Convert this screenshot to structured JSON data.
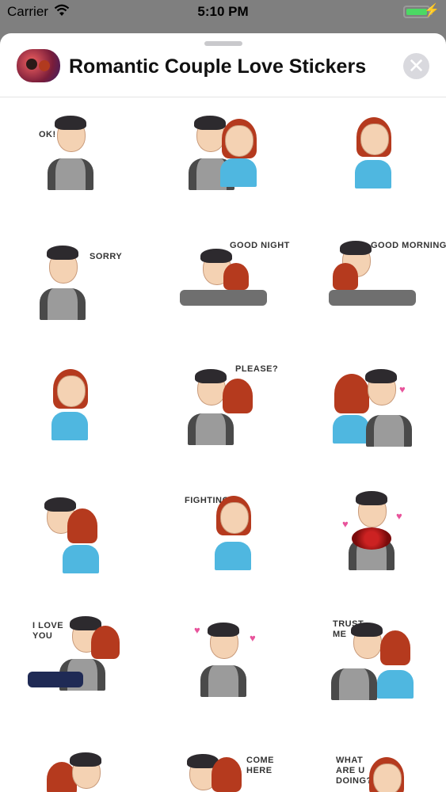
{
  "status_bar": {
    "carrier": "Carrier",
    "time": "5:10 PM"
  },
  "header": {
    "title": "Romantic Couple Love Stickers",
    "close_symbol": "✕"
  },
  "stickers": [
    {
      "caption": "OK!"
    },
    {
      "caption": ""
    },
    {
      "caption": ""
    },
    {
      "caption": "SORRY"
    },
    {
      "caption": "GOOD NIGHT"
    },
    {
      "caption": "GOOD MORNING"
    },
    {
      "caption": ""
    },
    {
      "caption": "PLEASE?"
    },
    {
      "caption": ""
    },
    {
      "caption": ""
    },
    {
      "caption": "FIGHTING!"
    },
    {
      "caption": ""
    },
    {
      "caption": "I LOVE\nYOU"
    },
    {
      "caption": ""
    },
    {
      "caption": "TRUST\nME"
    },
    {
      "caption": ""
    },
    {
      "caption": "COME\nHERE"
    },
    {
      "caption": "WHAT\nARE U\nDOING?"
    }
  ],
  "colors": {
    "battery": "#4cd964",
    "hair_female": "#b53a1e",
    "shirt_female": "#4fb7e0",
    "shirt_male": "#9b9b9b"
  }
}
